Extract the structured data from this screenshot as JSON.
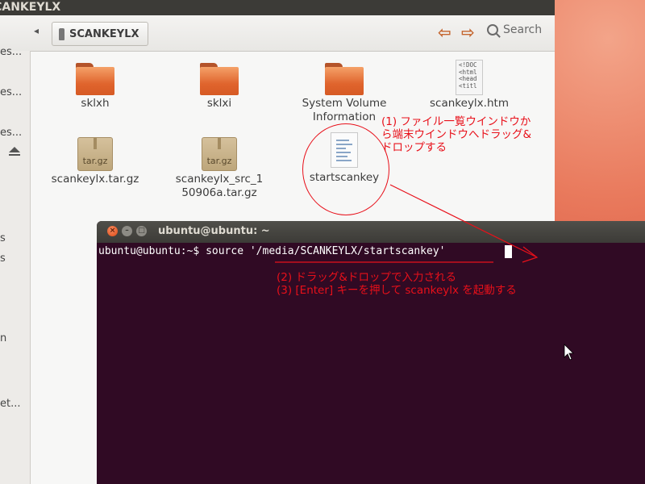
{
  "wallpaper_color": "#e0674b",
  "file_manager": {
    "title": "SCANKEYLX",
    "location": "SCANKEYLX",
    "search_label": "Search",
    "sidebar_items": [
      "es...",
      "es...",
      "es...",
      "s",
      "s",
      "n",
      "et..."
    ],
    "files": [
      {
        "name": "sklxh",
        "icon": "folder-icon"
      },
      {
        "name": "sklxi",
        "icon": "folder-icon"
      },
      {
        "name": "System Volume Information",
        "icon": "folder-icon"
      },
      {
        "name": "scankeylx.htm",
        "icon": "html-file-icon",
        "preview": [
          "<!DOC",
          "<html",
          "<head",
          "<titl"
        ]
      },
      {
        "name": "scankeylx.tar.gz",
        "icon": "archive-icon",
        "badge": "tar.gz"
      },
      {
        "name": "scankeylx_src_150906a.tar.gz",
        "icon": "archive-icon",
        "badge": "tar.gz"
      },
      {
        "name": "startscankey",
        "icon": "script-file-icon"
      }
    ]
  },
  "annotations": {
    "step1_line1": "(1) ファイル一覧ウインドウか",
    "step1_line2": "ら端末ウインドウへドラッグ&",
    "step1_line3": "ドロップする",
    "step2": "(2) ドラッグ&ドロップで入力される",
    "step3": "(3) [Enter] キーを押して scankeylx を起動する",
    "color": "#e8101a"
  },
  "terminal": {
    "title": "ubuntu@ubuntu: ~",
    "prompt": "ubuntu@ubuntu:~$ ",
    "command": "source '/media/SCANKEYLX/startscankey' ",
    "background": "#300a24"
  }
}
